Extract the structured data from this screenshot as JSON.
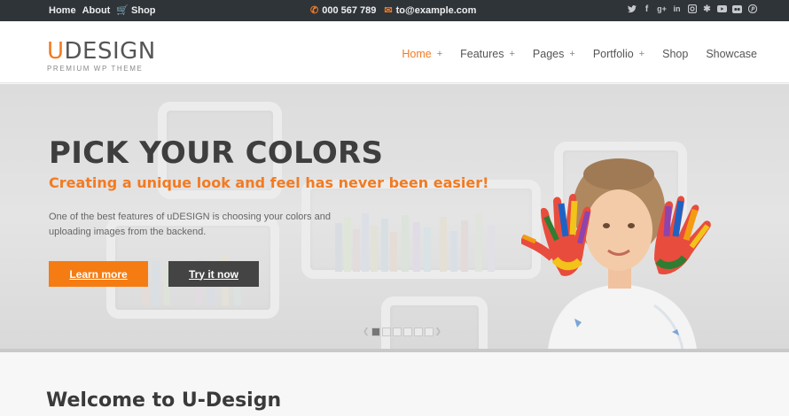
{
  "topbar": {
    "links": [
      "Home",
      "About",
      "Shop"
    ],
    "phone": "000 567 789",
    "email": "to@example.com",
    "social_icons": [
      "twitter-icon",
      "facebook-icon",
      "google-plus-icon",
      "linkedin-icon",
      "instagram-icon",
      "yelp-icon",
      "youtube-icon",
      "flickr-icon",
      "pinterest-icon"
    ]
  },
  "logo": {
    "first": "U",
    "rest": "DESIGN",
    "tagline": "PREMIUM WP THEME"
  },
  "nav": {
    "items": [
      {
        "label": "Home",
        "plus": "+"
      },
      {
        "label": "Features",
        "plus": "+"
      },
      {
        "label": "Pages",
        "plus": "+"
      },
      {
        "label": "Portfolio",
        "plus": "+"
      },
      {
        "label": "Shop",
        "plus": ""
      },
      {
        "label": "Showcase",
        "plus": ""
      }
    ]
  },
  "hero": {
    "title": "PICK YOUR COLORS",
    "subtitle": "Creating a unique look and feel has never been easier!",
    "description": "One of the best features of uDESIGN is choosing your colors and uploading images from the backend.",
    "learn_more": "Learn more",
    "try_now": "Try it now",
    "slide_count": 6,
    "active_slide": 1
  },
  "welcome": {
    "title": "Welcome to U-Design"
  },
  "colors": {
    "accent": "#f27b22",
    "topbar": "#2f3439",
    "dark_button": "#444444"
  }
}
